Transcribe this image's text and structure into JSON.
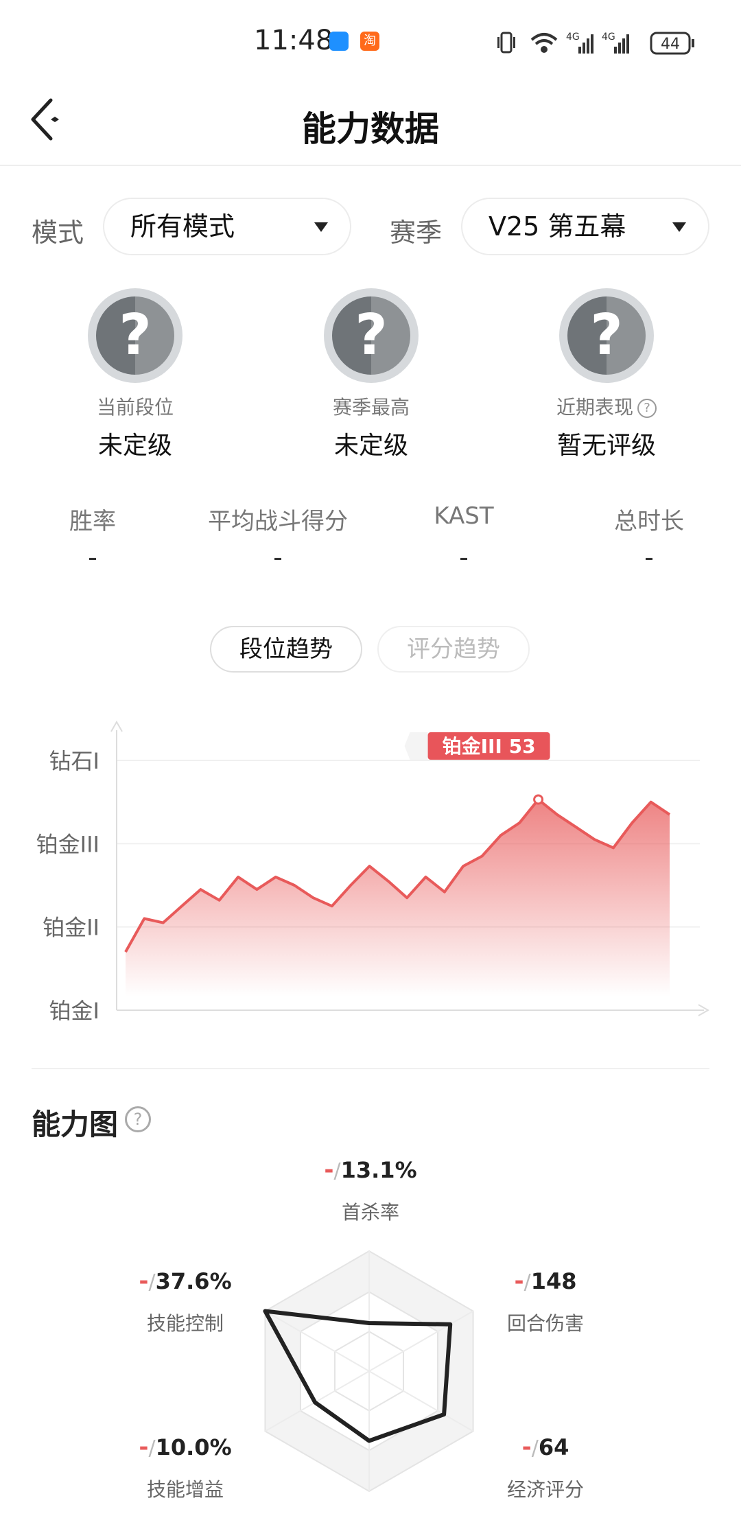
{
  "status_bar": {
    "time": "11:48",
    "taobao_glyph": "淘",
    "battery": "44"
  },
  "header": {
    "title": "能力数据"
  },
  "filters": {
    "mode_label": "模式",
    "mode_value": "所有模式",
    "season_label": "赛季",
    "season_value": "V25 第五幕"
  },
  "ranks": [
    {
      "label": "当前段位",
      "value": "未定级"
    },
    {
      "label": "赛季最高",
      "value": "未定级"
    },
    {
      "label": "近期表现",
      "value": "暂无评级"
    }
  ],
  "badge_glyph": "?",
  "stats": [
    {
      "label": "胜率",
      "value": "-"
    },
    {
      "label": "平均战斗得分",
      "value": "-"
    },
    {
      "label": "KAST",
      "value": "-"
    },
    {
      "label": "总时长",
      "value": "-"
    }
  ],
  "chart_tabs": {
    "rank": "段位趋势",
    "score": "评分趋势"
  },
  "chart_data": {
    "type": "area",
    "y_ticks": [
      "铂金I",
      "铂金II",
      "铂金III",
      "钻石I"
    ],
    "ylim": [
      0,
      3
    ],
    "values": [
      0.7,
      1.1,
      1.05,
      1.25,
      1.45,
      1.32,
      1.6,
      1.45,
      1.6,
      1.5,
      1.35,
      1.25,
      1.5,
      1.73,
      1.55,
      1.35,
      1.6,
      1.42,
      1.73,
      1.85,
      2.1,
      2.25,
      2.53,
      2.35,
      2.2,
      2.05,
      1.95,
      2.25,
      2.5,
      2.35
    ],
    "color": "#e85a5a",
    "tooltip": {
      "label": "铂金III 53",
      "index": 22
    }
  },
  "ability": {
    "title": "能力图",
    "help_glyph": "?",
    "axes": [
      {
        "name": "首杀率",
        "value": "13.1%"
      },
      {
        "name": "回合伤害",
        "value": "148"
      },
      {
        "name": "经济评分",
        "value": "64"
      },
      {
        "name": "技能增益",
        "value": "10.0%"
      },
      {
        "name": "技能控制",
        "value": "37.6%"
      }
    ],
    "dash": "-",
    "slash": "/",
    "radar_values": [
      0.4,
      0.78,
      0.72,
      0.58,
      0.52,
      1.0
    ]
  }
}
